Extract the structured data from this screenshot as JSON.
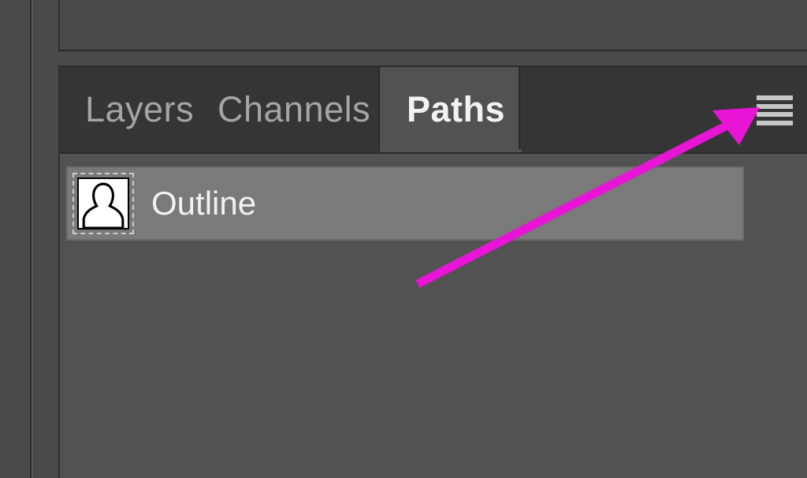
{
  "panel": {
    "tabs": [
      {
        "label": "Layers",
        "active": false
      },
      {
        "label": "Channels",
        "active": false
      },
      {
        "label": "Paths",
        "active": true
      }
    ],
    "flyout_icon": "hamburger-icon"
  },
  "paths": {
    "items": [
      {
        "name": "Outline",
        "thumb": "silhouette"
      }
    ]
  },
  "annotation": {
    "arrow_color": "#e815d7"
  }
}
